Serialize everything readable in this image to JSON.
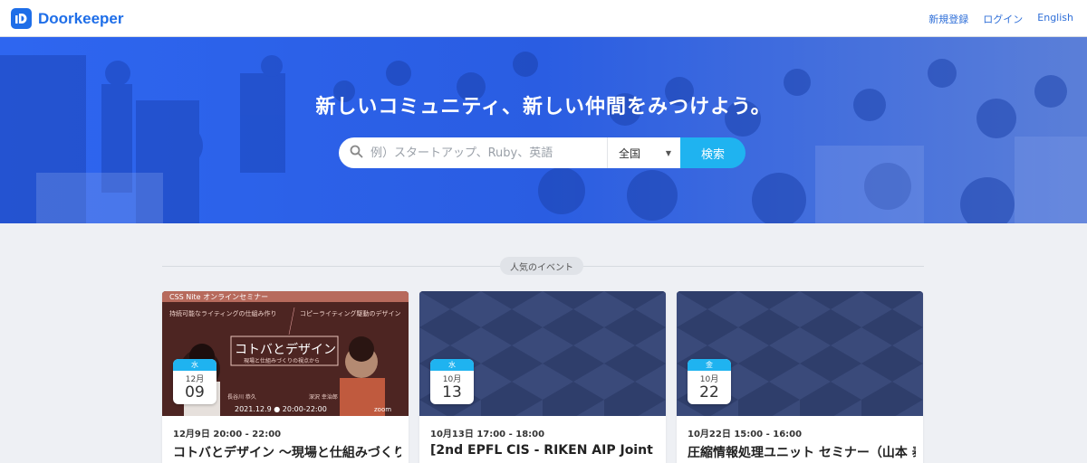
{
  "brand": {
    "name": "Doorkeeper",
    "color": "#1e6ee8"
  },
  "nav": {
    "signup": "新規登録",
    "login": "ログイン",
    "language": "English"
  },
  "hero": {
    "title": "新しいコミュニティ、新しい仲間をみつけよう。",
    "search_placeholder": "例）スタートアップ、Ruby、英語",
    "region": "全国",
    "search_button": "検索"
  },
  "section": {
    "label": "人気のイベント"
  },
  "events": [
    {
      "day": "水",
      "month": "12月",
      "date": "09",
      "time": "12月9日 20:00 - 22:00",
      "title": "コトバとデザイン 〜現場と仕組みづくり",
      "image": {
        "header": "CSS Nite オンラインセミナー",
        "left_topic": "持続可能なライティングの仕組み作り",
        "right_topic": "コピーライティング駆動のデザイン",
        "center_title": "コトバとデザイン",
        "center_subtitle": "現場と仕組みづくりの視点から",
        "speaker_left": "長谷川 恭久",
        "speaker_right": "深沢 幸治郎",
        "date_line": "2021.12.9 ● 20:00-22:00",
        "zoom": "zoom"
      }
    },
    {
      "day": "水",
      "month": "10月",
      "date": "13",
      "time": "10月13日 17:00 - 18:00",
      "title": "[2nd EPFL CIS - RIKEN AIP Joint"
    },
    {
      "day": "金",
      "month": "10月",
      "date": "22",
      "time": "10月22日 15:00 - 16:00",
      "title": "圧縮情報処理ユニット セミナー（山本 泰"
    }
  ]
}
